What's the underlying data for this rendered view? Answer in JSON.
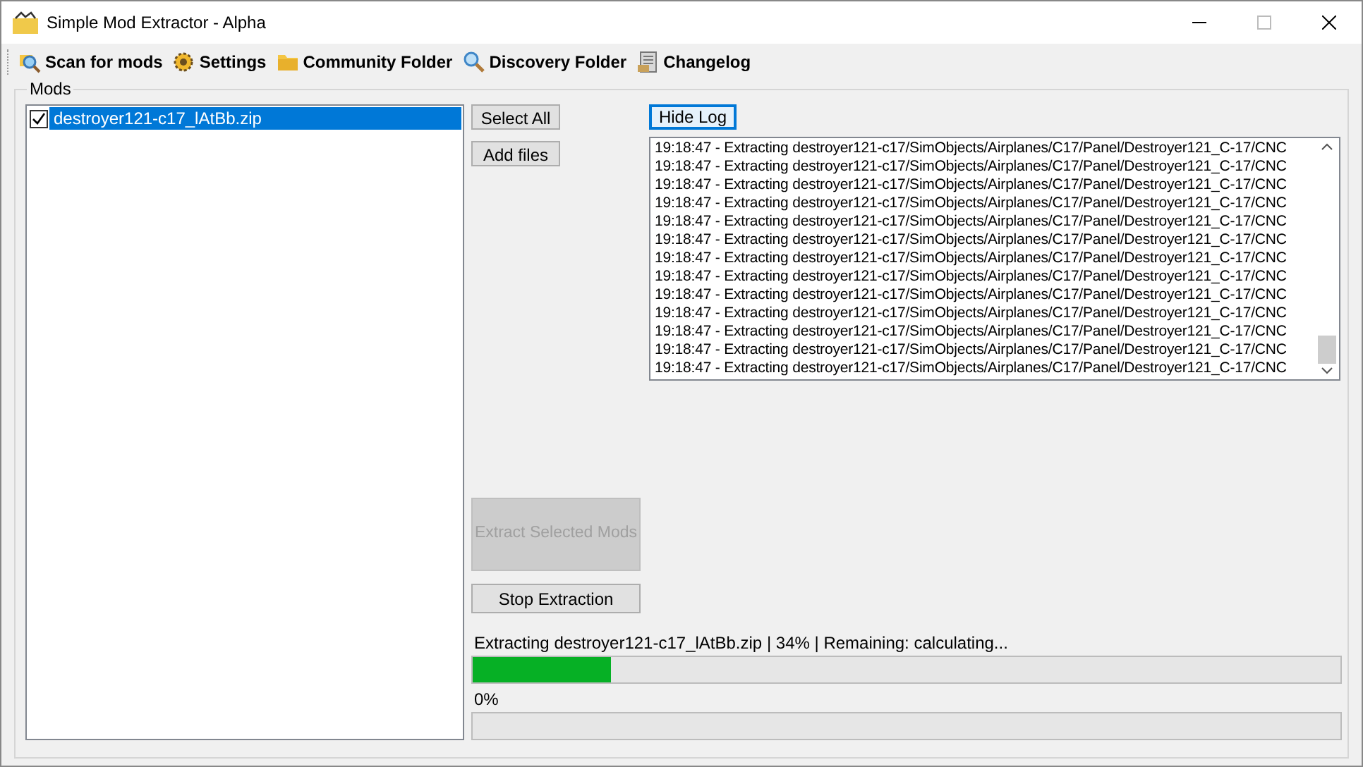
{
  "window": {
    "title": "Simple Mod Extractor - Alpha"
  },
  "toolbar": [
    {
      "label": "Scan for mods",
      "kind": "scan"
    },
    {
      "label": "Settings",
      "kind": "settings"
    },
    {
      "label": "Community Folder",
      "kind": "folder"
    },
    {
      "label": "Discovery Folder",
      "kind": "search"
    },
    {
      "label": "Changelog",
      "kind": "log"
    }
  ],
  "mods_group": {
    "title": "Mods",
    "items": [
      {
        "name": "destroyer121-c17_lAtBb.zip",
        "checked": true,
        "selected": true
      }
    ]
  },
  "buttons": {
    "select_all": "Select All",
    "add_files": "Add files",
    "hide_log": "Hide Log",
    "extract": {
      "label": "Extract Selected Mods",
      "disabled": true
    },
    "stop": {
      "label": "Stop Extraction",
      "disabled": false
    }
  },
  "log": [
    "19:18:47 - Extracting destroyer121-c17/SimObjects/Airplanes/C17/Panel/Destroyer121_C-17/CNC",
    "19:18:47 - Extracting destroyer121-c17/SimObjects/Airplanes/C17/Panel/Destroyer121_C-17/CNC",
    "19:18:47 - Extracting destroyer121-c17/SimObjects/Airplanes/C17/Panel/Destroyer121_C-17/CNC",
    "19:18:47 - Extracting destroyer121-c17/SimObjects/Airplanes/C17/Panel/Destroyer121_C-17/CNC",
    "19:18:47 - Extracting destroyer121-c17/SimObjects/Airplanes/C17/Panel/Destroyer121_C-17/CNC",
    "19:18:47 - Extracting destroyer121-c17/SimObjects/Airplanes/C17/Panel/Destroyer121_C-17/CNC",
    "19:18:47 - Extracting destroyer121-c17/SimObjects/Airplanes/C17/Panel/Destroyer121_C-17/CNC",
    "19:18:47 - Extracting destroyer121-c17/SimObjects/Airplanes/C17/Panel/Destroyer121_C-17/CNC",
    "19:18:47 - Extracting destroyer121-c17/SimObjects/Airplanes/C17/Panel/Destroyer121_C-17/CNC",
    "19:18:47 - Extracting destroyer121-c17/SimObjects/Airplanes/C17/Panel/Destroyer121_C-17/CNC",
    "19:18:47 - Extracting destroyer121-c17/SimObjects/Airplanes/C17/Panel/Destroyer121_C-17/CNC",
    "19:18:47 - Extracting destroyer121-c17/SimObjects/Airplanes/C17/Panel/Destroyer121_C-17/CNC",
    "19:18:47 - Extracting destroyer121-c17/SimObjects/Airplanes/C17/Panel/Destroyer121_C-17/CNC"
  ],
  "progress": [
    {
      "label": "Extracting destroyer121-c17_lAtBb.zip | 34% | Remaining: calculating...",
      "level": 0.16
    },
    {
      "label": "0%"
    }
  ]
}
